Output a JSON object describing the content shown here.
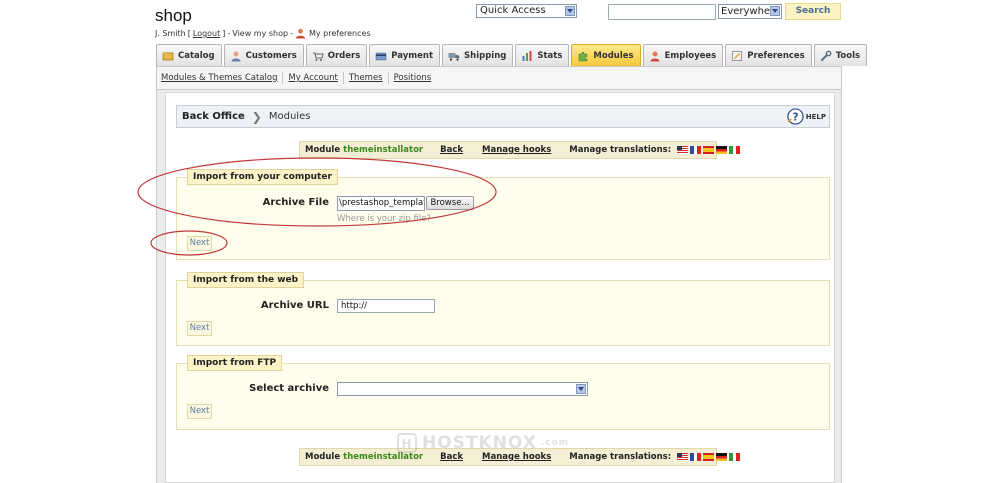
{
  "header": {
    "shop_title": "shop",
    "user_name": "J. Smith",
    "logout_label": "Logout",
    "view_shop_label": "View my shop",
    "preferences_label": "My preferences",
    "quick_access_label": "Quick Access",
    "search_value": "",
    "search_scope": "Everywhere",
    "search_button_label": "Search"
  },
  "tabs": [
    {
      "label": "Catalog",
      "icon": "catalog-icon",
      "active": false
    },
    {
      "label": "Customers",
      "icon": "customers-icon",
      "active": false
    },
    {
      "label": "Orders",
      "icon": "orders-icon",
      "active": false
    },
    {
      "label": "Payment",
      "icon": "payment-icon",
      "active": false
    },
    {
      "label": "Shipping",
      "icon": "shipping-icon",
      "active": false
    },
    {
      "label": "Stats",
      "icon": "stats-icon",
      "active": false
    },
    {
      "label": "Modules",
      "icon": "modules-icon",
      "active": true
    },
    {
      "label": "Employees",
      "icon": "employees-icon",
      "active": false
    },
    {
      "label": "Preferences",
      "icon": "preferences-icon",
      "active": false
    },
    {
      "label": "Tools",
      "icon": "tools-icon",
      "active": false
    }
  ],
  "subtabs": [
    "Modules & Themes Catalog",
    "My Account",
    "Themes",
    "Positions"
  ],
  "breadcrumb": {
    "section": "Back Office",
    "page": "Modules",
    "help_label": "HELP"
  },
  "module_bar": {
    "module_label": "Module",
    "module_name": "themeinstallator",
    "back_label": "Back",
    "manage_hooks_label": "Manage hooks",
    "manage_translations_label": "Manage translations:",
    "languages": [
      "en",
      "fr",
      "es",
      "de",
      "it"
    ]
  },
  "import_computer": {
    "legend": "Import from your computer",
    "field_label": "Archive File",
    "file_value": "\\prestashop_template_",
    "browse_label": "Browse...",
    "hint": "Where is your zip file?",
    "next_label": "Next"
  },
  "import_web": {
    "legend": "Import from the web",
    "field_label": "Archive URL",
    "url_value": "http://",
    "next_label": "Next"
  },
  "import_ftp": {
    "legend": "Import from FTP",
    "field_label": "Select archive",
    "selected": "",
    "next_label": "Next"
  },
  "watermark": {
    "text": "HOSTKNOX",
    "suffix": ".com"
  },
  "colors": {
    "active_tab": "#f6c93c",
    "module_name": "#3a8a1c",
    "annotation": "#c0393b",
    "fieldset_bg": "#fffdeb"
  }
}
